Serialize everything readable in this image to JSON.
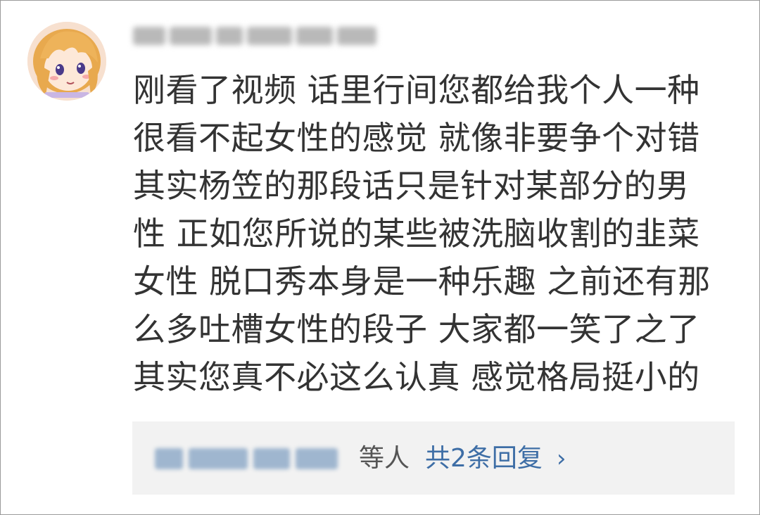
{
  "comment": {
    "lines": [
      "刚看了视频 话里行间您都给我个人一种",
      "很看不起女性的感觉 就像非要争个对错",
      "其实杨笠的那段话只是针对某部分的男",
      "性 正如您所说的某些被洗脑收割的韭菜",
      "女性 脱口秀本身是一种乐趣 之前还有那",
      "么多吐槽女性的段子 大家都一笑了之了",
      "其实您真不必这么认真 感觉格局挺小的"
    ]
  },
  "replies": {
    "others_label": "等人",
    "count_label": "共2条回复",
    "chevron": "›"
  },
  "watermark": "",
  "colors": {
    "text": "#333333",
    "link": "#3e6ea6",
    "reply_bg": "#f2f2f2"
  },
  "icons": {
    "avatar": "anime-girl-avatar",
    "chevron": "chevron-right-icon"
  }
}
